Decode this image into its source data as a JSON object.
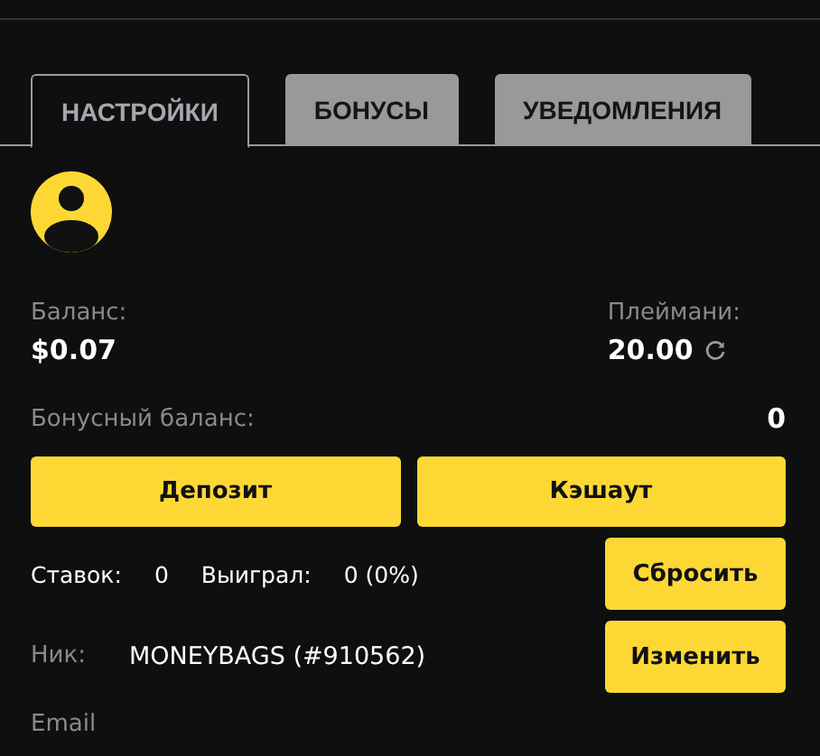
{
  "tabs": [
    {
      "label": "НАСТРОЙКИ",
      "selected": true
    },
    {
      "label": "БОНУСЫ",
      "selected": false
    },
    {
      "label": "УВЕДОМЛЕНИЯ",
      "selected": false
    }
  ],
  "balance": {
    "label": "Баланс:",
    "value": "$0.07"
  },
  "playmoney": {
    "label": "Плеймани:",
    "value": "20.00"
  },
  "bonus_balance": {
    "label": "Бонусный баланс:",
    "value": "0"
  },
  "buttons": [
    "Депозит",
    "Кэшаут"
  ],
  "stats": {
    "bets_label": "Ставок:",
    "bets_value": "0",
    "won_label": "Выиграл:",
    "won_value": "0 (0%)",
    "button": "Сбросить"
  },
  "nick": {
    "label": "Ник:",
    "value": "MONEYBAGS (#910562)",
    "button": "Изменить"
  },
  "email": {
    "label": "Email"
  }
}
